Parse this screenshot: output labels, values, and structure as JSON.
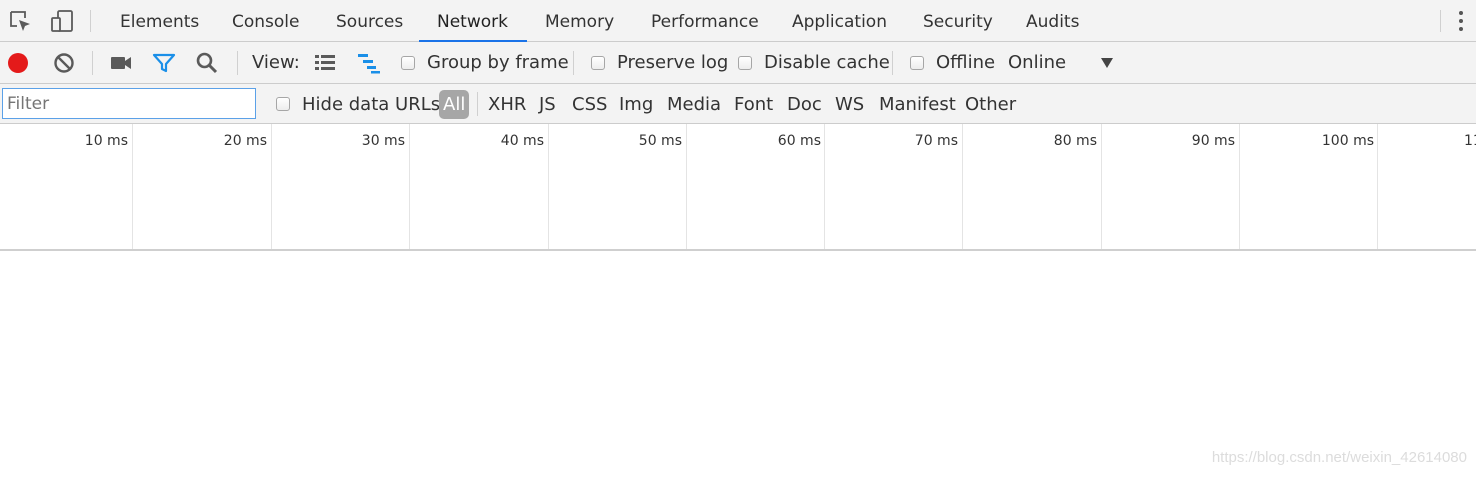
{
  "tabs": [
    "Elements",
    "Console",
    "Sources",
    "Network",
    "Memory",
    "Performance",
    "Application",
    "Security",
    "Audits"
  ],
  "selected_tab": "Network",
  "toolbar": {
    "view_label": "View:",
    "group_by_frame": "Group by frame",
    "preserve_log": "Preserve log",
    "disable_cache": "Disable cache",
    "offline": "Offline",
    "throttle_value": "Online",
    "record_color": "#e41a1a",
    "accent_color": "#1a8fe8"
  },
  "filterbar": {
    "placeholder": "Filter",
    "hide_data_urls": "Hide data URLs",
    "types": [
      "All",
      "XHR",
      "JS",
      "CSS",
      "Img",
      "Media",
      "Font",
      "Doc",
      "WS",
      "Manifest",
      "Other"
    ],
    "active_type": "All"
  },
  "overview": {
    "labels": [
      "10 ms",
      "20 ms",
      "30 ms",
      "40 ms",
      "50 ms",
      "60 ms",
      "70 ms",
      "80 ms",
      "90 ms",
      "100 ms",
      "11"
    ]
  },
  "watermark": "https://blog.csdn.net/weixin_42614080"
}
